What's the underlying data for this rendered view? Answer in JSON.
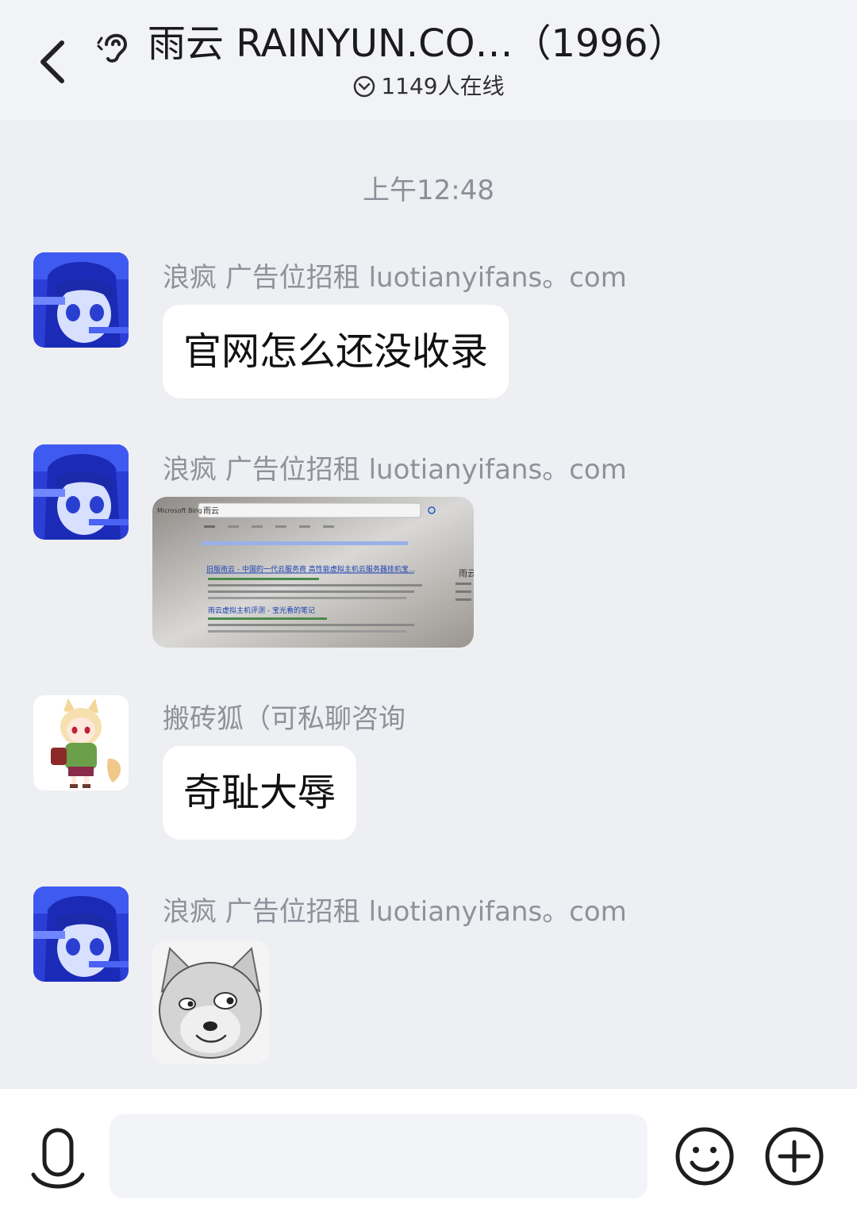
{
  "header": {
    "title": "雨云 RAINYUN.CO…（1996）",
    "online": "1149人在线"
  },
  "chat": {
    "timestamp": "上午12:48",
    "messages": [
      {
        "sender": "浪疯 广告位招租 luotianyifans。com",
        "text": "官网怎么还没收录"
      },
      {
        "sender": "浪疯 广告位招租 luotianyifans。com",
        "image": "search-results-photo"
      },
      {
        "sender": "搬砖狐（可私聊咨询",
        "text": "奇耻大辱"
      },
      {
        "sender": "浪疯 广告位招租 luotianyifans。com",
        "image": "doge-sticker"
      }
    ]
  },
  "screenshot_text": {
    "search_query": "雨云",
    "result1_title": "旧版雨云 - 中国的一代云服务商 高性能虚拟主机云服务器挂机宝...",
    "result2_title": "雨云虚拟主机评测 - 宝光看的笔记",
    "side_label": "雨云",
    "engine": "Microsoft Bing"
  },
  "composer": {
    "placeholder": ""
  }
}
